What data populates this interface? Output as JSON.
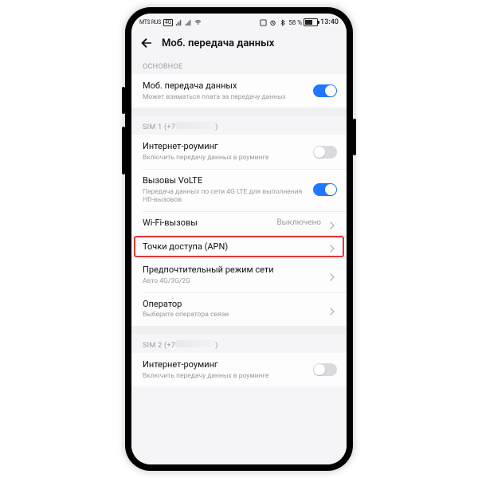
{
  "statusbar": {
    "carrier": "MTS RUS",
    "net_badge": "4G",
    "battery_pct": "58 %",
    "time": "13:40"
  },
  "header": {
    "title": "Моб. передача данных"
  },
  "sections": {
    "main_hdr": "ОСНОВНОЕ",
    "mobile_data": {
      "label": "Моб. передача данных",
      "sub": "Может взиматься плата за передачу данных",
      "on": true
    },
    "sim1_hdr_prefix": "SIM 1 (+7",
    "sim1_hdr_suffix": ")",
    "roaming1": {
      "label": "Интернет-роуминг",
      "sub": "Включить передачу данных в роуминге",
      "on": false
    },
    "volte": {
      "label": "Вызовы VoLTE",
      "sub": "Передача данных по сети 4G LTE для выполнения HD-вызовов",
      "on": true
    },
    "wifi_calls": {
      "label": "Wi-Fi-вызовы",
      "value": "Выключено"
    },
    "apn": {
      "label": "Точки доступа (APN)"
    },
    "net_mode": {
      "label": "Предпочтительный режим сети",
      "sub": "Авто 4G/3G/2G"
    },
    "operator": {
      "label": "Оператор",
      "sub": "Выберите оператора связи"
    },
    "sim2_hdr_prefix": "SIM 2 (+7",
    "sim2_hdr_suffix": ")",
    "roaming2": {
      "label": "Интернет-роуминг",
      "sub": "Включить передачу данных в роуминге",
      "on": false
    }
  }
}
